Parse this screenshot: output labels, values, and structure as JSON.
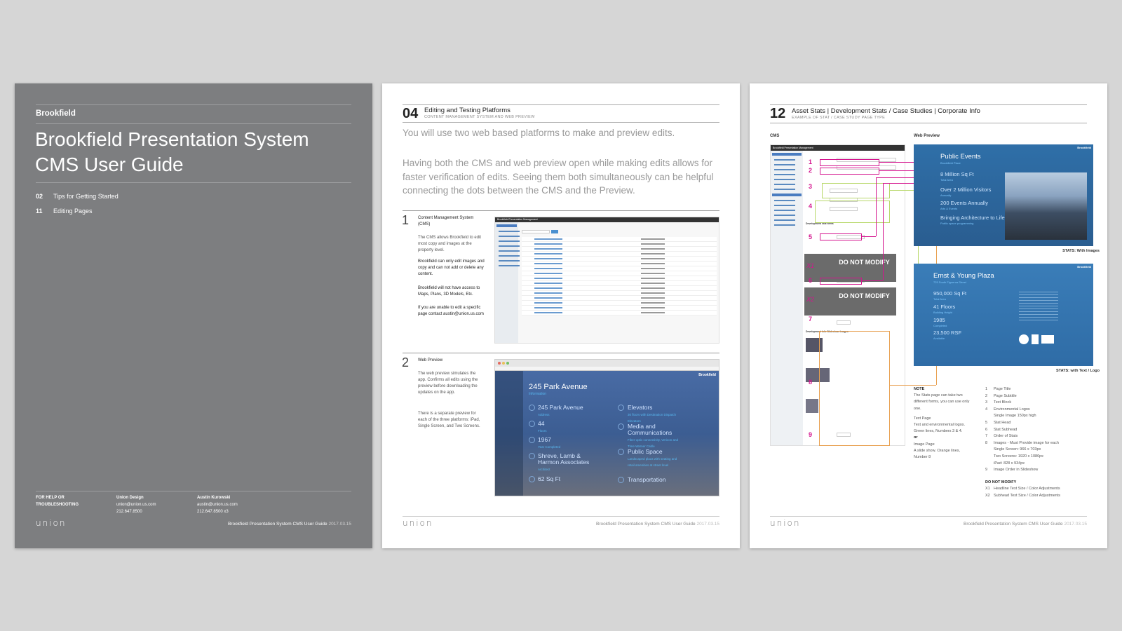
{
  "cover": {
    "brand": "Brookfield",
    "title_line1": "Brookfield Presentation System",
    "title_line2": "CMS User Guide",
    "toc": [
      {
        "num": "02",
        "label": "Tips for Getting Started"
      },
      {
        "num": "11",
        "label": "Editing Pages"
      }
    ],
    "help_label_1": "FOR HELP OR",
    "help_label_2": "TROUBLESHOOTING",
    "contact1": {
      "name": "Union Design",
      "email": "union@union.us.com",
      "phone": "212.647.8500"
    },
    "contact2": {
      "name": "Austin Kurowski",
      "email": "austin@union.us.com",
      "phone": "212.647.8500 x3"
    },
    "logo": "union",
    "footer": "Brookfield Presentation System CMS User Guide",
    "footer_date": "2017.03.15"
  },
  "page4": {
    "num": "04",
    "title": "Editing and Testing Platforms",
    "subtitle": "CONTENT MANAGEMENT SYSTEM AND WEB PREVIEW",
    "intro1": "You will use two web based platforms to make and preview edits.",
    "intro2": "Having both the CMS and web preview open while making edits allows for faster verification of edits. Seeing them both simultaneously can be helpful connecting the dots between the CMS and the Preview.",
    "s1_num": "1",
    "s1_title": "Content Management System (CMS)",
    "s1_p1": "The CMS allows Brookfield to edit most copy and images at the property level.",
    "s1_p2": "Brookfield can only edit images and copy and can not add or delete any content.",
    "s1_p3": "Brookfield will not have access to Maps, Plans, 3D Models, Etc.",
    "s1_p4": "If you are unable to edit a specific page contact austin@union.us.com",
    "cms_header": "Brookfield Presentation Management",
    "s2_num": "2",
    "s2_title": "Web Preview",
    "s2_p1": "The web preview simulates the app. Confirms all edits using the preview before downloading the updates on the app.",
    "s2_p2": "There is a separate preview for each of the three platforms: iPad, Single Screen, and Two Screens.",
    "preview": {
      "brand": "Brookfield",
      "title": "245 Park Avenue",
      "subtitle": "Information",
      "left_items": [
        {
          "label": "245 Park Avenue",
          "sub": "Address"
        },
        {
          "label": "44",
          "sub": "Floors"
        },
        {
          "label": "1967",
          "sub": "Year Completed"
        },
        {
          "label": "Shreve, Lamb & Harmon Associates",
          "sub": "Architect"
        },
        {
          "label": "62 Sq Ft",
          "sub": ""
        }
      ],
      "right_items": [
        {
          "label": "Elevators",
          "sub": "30 floors with Destination Dispatch Elevators"
        },
        {
          "label": "Media and Communications",
          "sub": "Fiber-optic connectivity, Verizon and Time Warner Cable"
        },
        {
          "label": "Public Space",
          "sub": "Landscaped plaza with seating and retail amenities at street level"
        },
        {
          "label": "Transportation",
          "sub": ""
        }
      ]
    },
    "logo": "union",
    "footer": "Brookfield Presentation System CMS User Guide",
    "footer_date": "2017.03.15"
  },
  "page12": {
    "num": "12",
    "title": "Asset Stats | Development Stats / Case Studies | Corporate Info",
    "subtitle": "EXAMPLE OF STAT / CASE STUDY PAGE TYPE",
    "cms_label": "CMS",
    "web_label": "Web Preview",
    "cms_header": "Brookfield Presentation Management",
    "dev_stat_items": "Development Stat Items",
    "dev_info": "Development Info Slideshow Images",
    "do_not_modify_1": "DO NOT MODIFY",
    "do_not_modify_2": "DO NOT MODIFY",
    "x1": "X1",
    "x2": "X2",
    "markers": [
      "1",
      "2",
      "3",
      "4",
      "5",
      "6",
      "7",
      "8",
      "9"
    ],
    "preview1": {
      "brand": "Brookfield",
      "title": "Public Events",
      "subtitle": "Brookfield Place",
      "stats": [
        {
          "v": "8 Million Sq Ft",
          "s": "Total Area"
        },
        {
          "v": "Over 2 Million Visitors",
          "s": "Annually"
        },
        {
          "v": "200 Events Annually",
          "s": "Arts & Events"
        },
        {
          "v": "Bringing Architecture to Life",
          "s": "Public space programming"
        }
      ],
      "caption": "STATS: With Images"
    },
    "preview2": {
      "brand": "Brookfield",
      "title": "Ernst & Young Plaza",
      "subtitle": "725 South Figueroa Street",
      "stats": [
        {
          "v": "950,000 Sq Ft",
          "s": "Total Area"
        },
        {
          "v": "41 Floors",
          "s": "Building Height"
        },
        {
          "v": "1985",
          "s": "Completed"
        },
        {
          "v": "23,500 RSF",
          "s": "Available"
        }
      ],
      "caption": "STATS: with Text / Logo"
    },
    "note_title": "NOTE",
    "note_body": "The Stats page can take two different forms, you can use only one.",
    "note_text_page": "Text Page",
    "note_text_desc": "Text and environmental logos. Green lines, Numbers 3 & 4.",
    "note_or": "or",
    "note_image_page": "Image Page",
    "note_image_desc": "A slide show. Orange lines, Number 8",
    "legend": [
      {
        "n": "1",
        "t": "Page Title"
      },
      {
        "n": "2",
        "t": "Page Subtitle"
      },
      {
        "n": "3",
        "t": "Text Block"
      },
      {
        "n": "4",
        "t": "Environmental Logos"
      },
      {
        "n": "",
        "t": "Single Image 150px high"
      },
      {
        "n": "5",
        "t": "Stat Head"
      },
      {
        "n": "6",
        "t": "Stat Subhead"
      },
      {
        "n": "7",
        "t": "Order of Stats"
      },
      {
        "n": "8",
        "t": "Images - Must Provide image for each"
      },
      {
        "n": "",
        "t": "Single Screen: 966 x 703px"
      },
      {
        "n": "",
        "t": "Two Screens: 1920 x 1080px"
      },
      {
        "n": "",
        "t": "iPad: 828 x 934px"
      },
      {
        "n": "9",
        "t": "Image Order in Slideshow"
      }
    ],
    "dnm_title": "DO NOT MODIFY",
    "dnm_items": [
      {
        "n": "X1",
        "t": "Headline Text Size / Color Adjustments"
      },
      {
        "n": "X2",
        "t": "Subhead Text Size / Color Adjustments"
      }
    ],
    "logo": "union",
    "footer": "Brookfield Presentation System CMS User Guide",
    "footer_date": "2017.03.15"
  },
  "colors": {
    "cover_bg": "#7d7e80",
    "magenta": "#d4148e",
    "preview_blue": "#2f6fa8",
    "dark_blue": "#2a3f6a"
  }
}
